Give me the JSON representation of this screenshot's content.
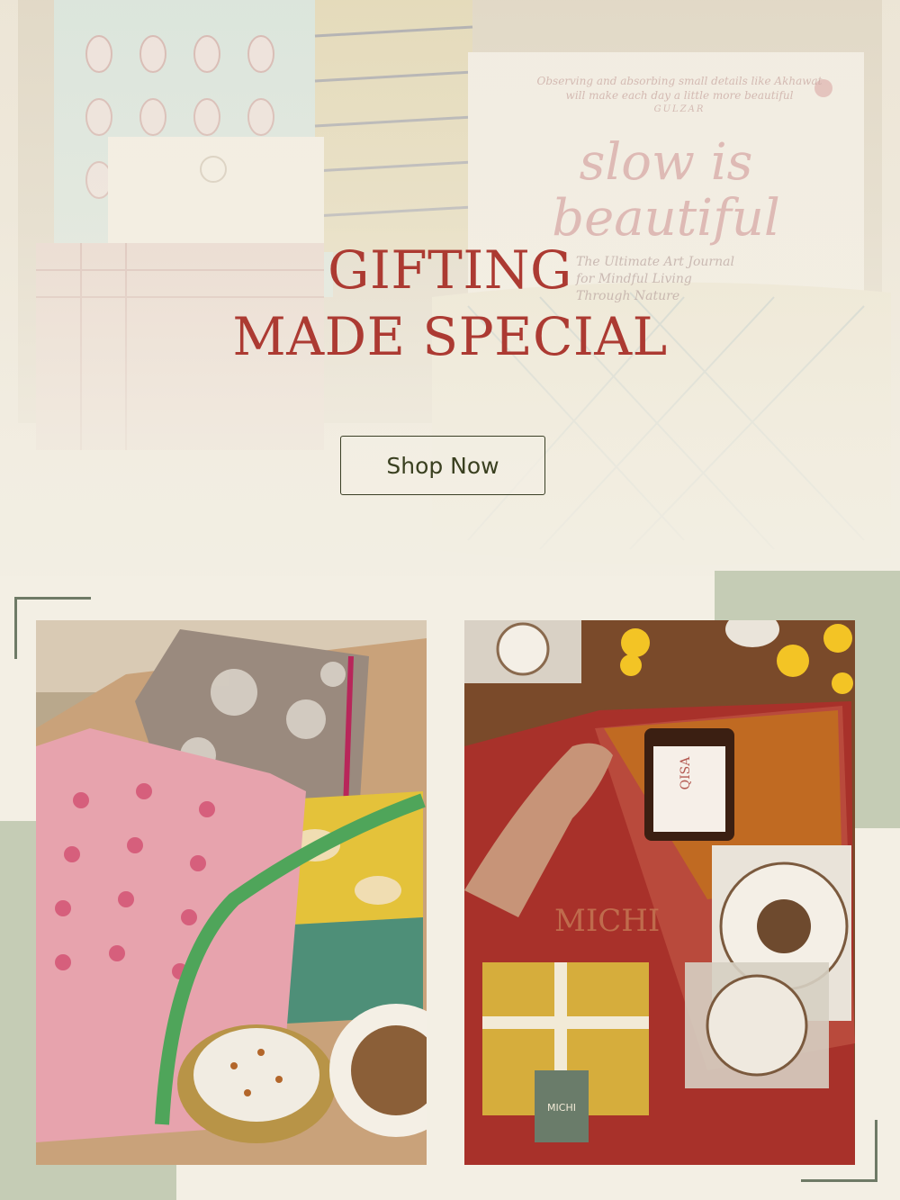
{
  "hero": {
    "headline_line1": "GIFTING",
    "headline_line2": "MADE SPECIAL",
    "cta_label": "Shop Now"
  },
  "background_book": {
    "quote_line1": "Observing and absorbing small details like Akhawat",
    "quote_line2": "will make each day a little more beautiful",
    "quote_author": "GULZAR",
    "title_line1": "slow is",
    "title_line2": "beautiful",
    "subtitle_line1": "The Ultimate Art Journal",
    "subtitle_line2": "for Mindful Living",
    "subtitle_line3": "Through Nature"
  },
  "photo_right": {
    "candle_label": "QISA",
    "box_brand": "MICHI",
    "tag_brand": "MICHI"
  },
  "colors": {
    "background": "#f3efe4",
    "headline": "#ac3a32",
    "button_border": "#3a3f25",
    "accent_green": "#c5ccb5"
  }
}
